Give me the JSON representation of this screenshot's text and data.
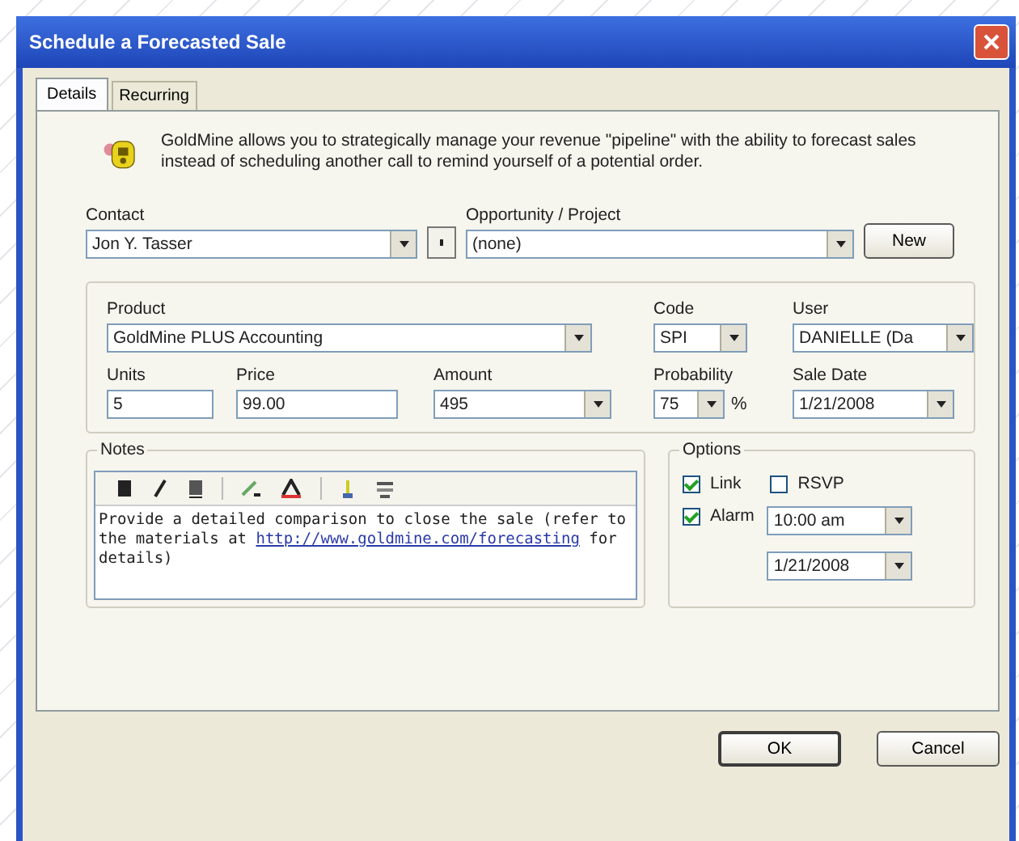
{
  "window": {
    "title": "Schedule a Forecasted Sale"
  },
  "tabs": [
    {
      "label": "Details",
      "selected": true
    },
    {
      "label": "Recurring",
      "selected": false
    }
  ],
  "intro": "GoldMine allows you to strategically manage your revenue \"pipeline\" with the ability to forecast sales instead of scheduling another call to remind yourself of a potential order.",
  "contact": {
    "label": "Contact",
    "value": "Jon Y. Tasser"
  },
  "opportunity": {
    "label": "Opportunity / Project",
    "value": "(none)"
  },
  "new_button": "New",
  "product": {
    "label": "Product",
    "value": "GoldMine PLUS Accounting"
  },
  "code": {
    "label": "Code",
    "value": "SPI"
  },
  "user": {
    "label": "User",
    "value": "DANIELLE (Da"
  },
  "units": {
    "label": "Units",
    "value": "5"
  },
  "price": {
    "label": "Price",
    "value": "99.00"
  },
  "amount": {
    "label": "Amount",
    "value": "495"
  },
  "probability": {
    "label": "Probability",
    "value": "75",
    "suffix": "%"
  },
  "sale_date": {
    "label": "Sale Date",
    "value": "1/21/2008"
  },
  "notes": {
    "label": "Notes",
    "text": "Provide a detailed comparison to close the sale (refer to the materials at",
    "link": "http://www.goldmine.com/forecasting",
    "after": "for details)"
  },
  "options": {
    "label": "Options",
    "checks": [
      {
        "label": "Link",
        "checked": true
      },
      {
        "label": "RSVP",
        "checked": false
      }
    ],
    "alarm": {
      "label": "Alarm",
      "checked": true,
      "time": "10:00 am",
      "date": "1/21/2008"
    }
  },
  "buttons": [
    "OK",
    "Cancel"
  ]
}
